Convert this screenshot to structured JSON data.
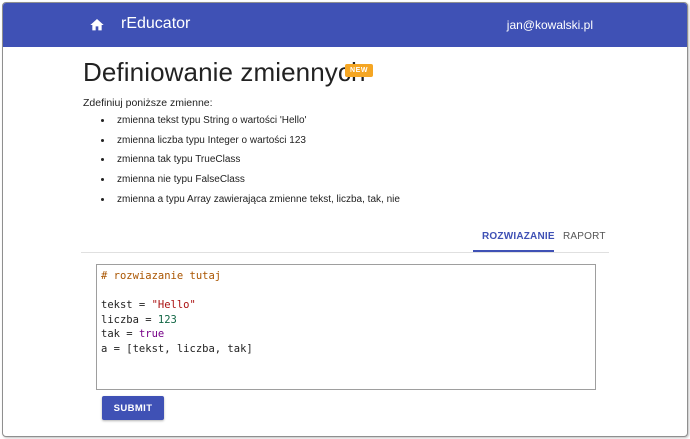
{
  "header": {
    "home_icon": "home-icon",
    "brand": "rEducator",
    "user_email": "jan@kowalski.pl",
    "bar_color": "#3f51b5"
  },
  "page": {
    "title": "Definiowanie zmiennych",
    "badge": "NEW",
    "badge_color": "#f5a623",
    "intro": "Zdefiniuj poniższe zmienne:",
    "tasks": [
      "zmienna tekst typu String o wartości 'Hello'",
      "zmienna liczba typu Integer o wartości 123",
      "zmienna tak typu TrueClass",
      "zmienna nie typu FalseClass",
      "zmienna a typu Array zawierająca zmienne tekst, liczba, tak, nie"
    ]
  },
  "tabs": {
    "solution": "ROZWIAZANIE",
    "report": "RAPORT",
    "active": "solution"
  },
  "editor": {
    "comment": "# rozwiazanie tutaj",
    "line_tekst_a": "tekst = ",
    "line_tekst_b": "\"Hello\"",
    "line_liczba_a": "liczba = ",
    "line_liczba_b": "123",
    "line_tak_a": "tak = ",
    "line_tak_b": "true",
    "line_array": "a = [tekst, liczba, tak]"
  },
  "actions": {
    "submit_label": "SUBMIT"
  }
}
